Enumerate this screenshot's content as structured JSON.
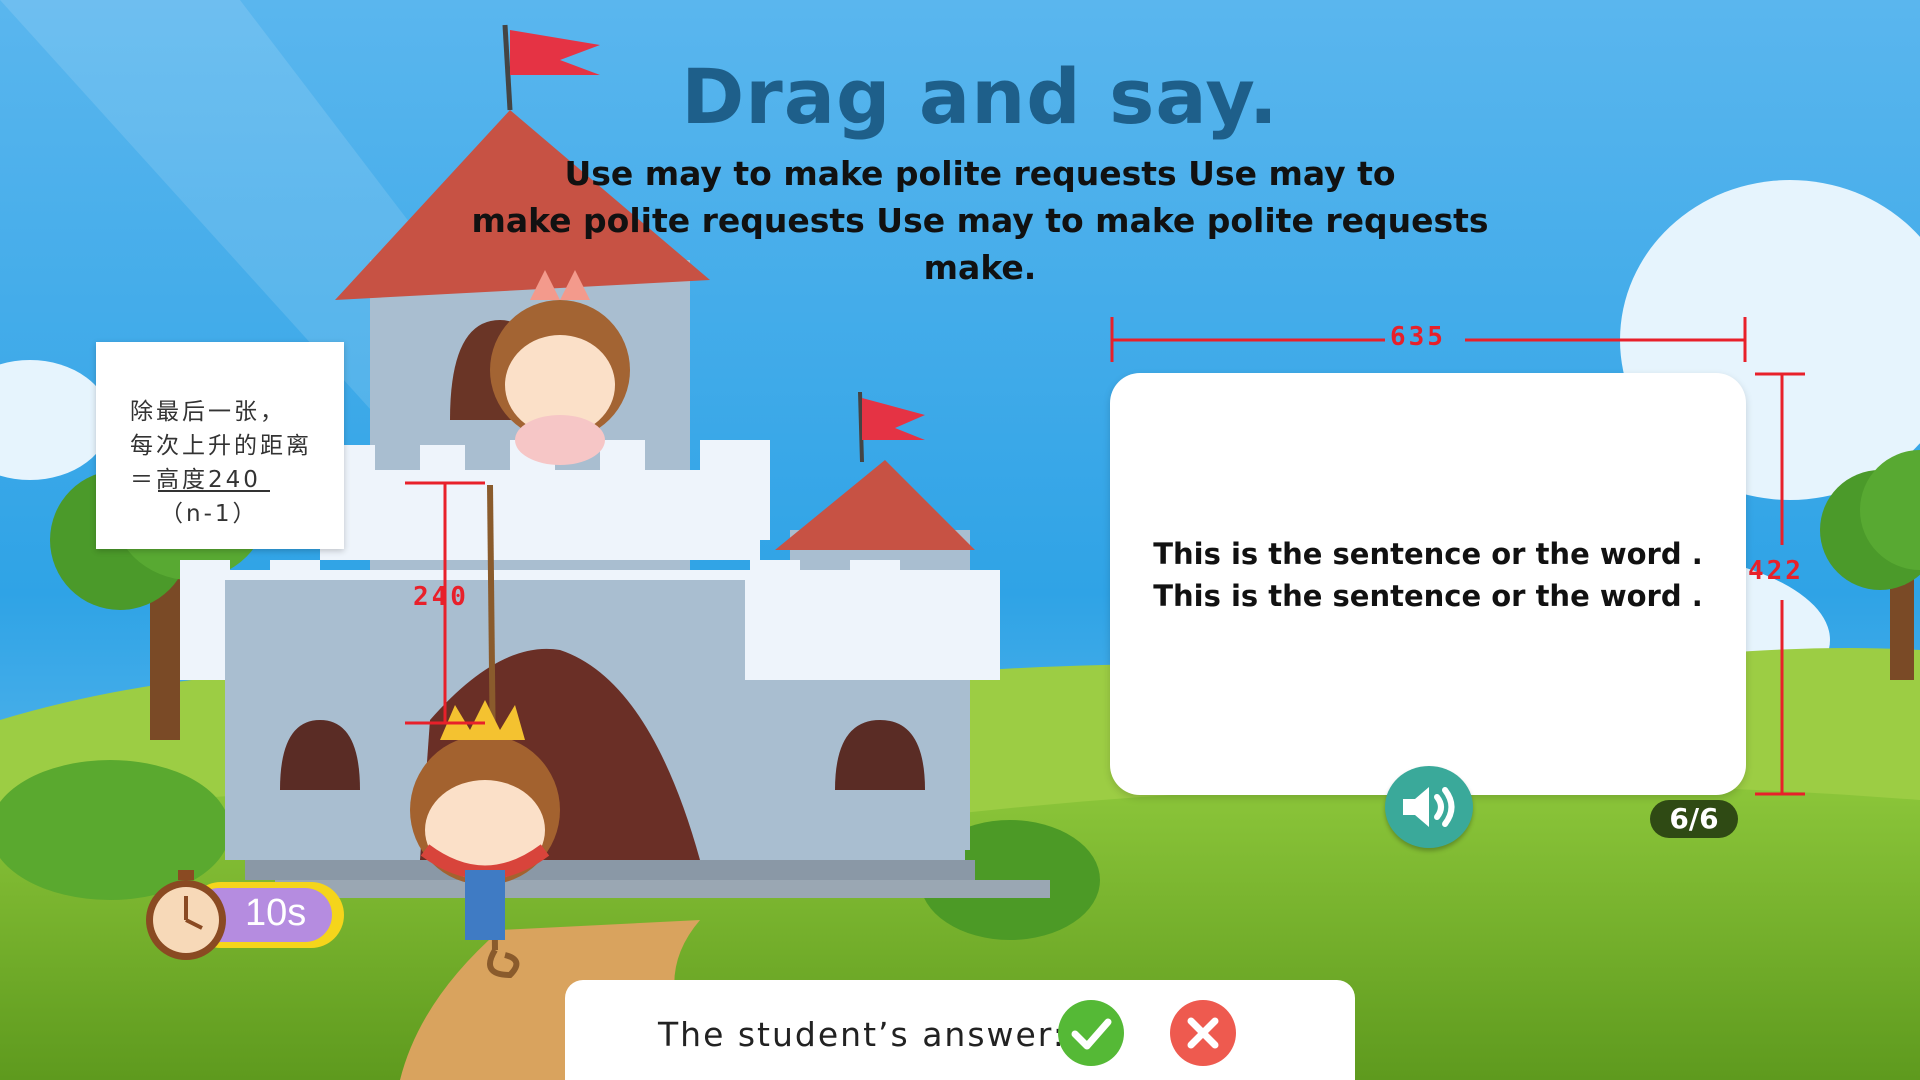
{
  "activity": {
    "title": "Drag and say.",
    "instruction_line1": "Use may to make polite requests Use may to",
    "instruction_line2": "make polite requests Use may to make polite requests make."
  },
  "note": {
    "line1": "除最后一张，",
    "line2": "每次上升的距离",
    "line3": "＝高度240",
    "line4": "（n-1）"
  },
  "annotations": {
    "rope_height": "240",
    "card_width": "635",
    "card_height": "422"
  },
  "card": {
    "sentence1": "This is the sentence or the word .",
    "sentence2": "This is the sentence or the word ."
  },
  "counter": "6/6",
  "timer": {
    "value": "10s"
  },
  "answer_bar": {
    "label": "The student’s answer:"
  },
  "colors": {
    "sky": "#39a6e6",
    "grass": "#7db62d",
    "title": "#1e5f8a",
    "annotation_red": "#e8202a",
    "speaker_button": "#3aa99a",
    "correct_button": "#55b936",
    "wrong_button": "#ee5a4f",
    "timer_pill": "#b58ce0",
    "counter_badge": "#2f4a14"
  },
  "icons": {
    "speaker": "speaker-icon",
    "correct": "check-icon",
    "wrong": "close-icon",
    "timer": "stopwatch-icon"
  }
}
